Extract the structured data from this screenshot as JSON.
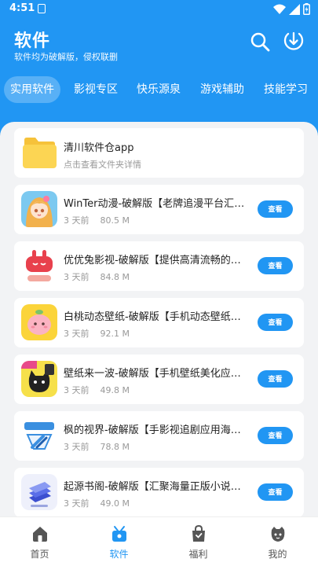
{
  "status_bar": {
    "time": "4:51"
  },
  "header": {
    "title": "软件",
    "subtitle": "软件均为破解版，侵权联删"
  },
  "tabs": [
    {
      "label": "实用软件",
      "active": true
    },
    {
      "label": "影视专区",
      "active": false
    },
    {
      "label": "快乐源泉",
      "active": false
    },
    {
      "label": "游戏辅助",
      "active": false
    },
    {
      "label": "技能学习",
      "active": false
    }
  ],
  "folder": {
    "name": "清川软件仓app",
    "hint": "点击查看文件夹详情"
  },
  "apps": [
    {
      "name": "WinTer动漫-破解版【老牌追漫平台汇聚海量动漫资源】",
      "time": "3 天前",
      "size": "80.5 M",
      "button": "查看",
      "icon": "anime-girl-icon"
    },
    {
      "name": "优优兔影视-破解版【提供高清流畅的影视资源】",
      "time": "3 天前",
      "size": "84.8 M",
      "button": "查看",
      "icon": "red-rabbit-icon"
    },
    {
      "name": "白桃动态壁纸-破解版【手机动态壁纸应用】",
      "time": "3 天前",
      "size": "92.1 M",
      "button": "查看",
      "icon": "peach-icon"
    },
    {
      "name": "壁纸来一波-破解版【手机壁纸美化应用】",
      "time": "3 天前",
      "size": "49.8 M",
      "button": "查看",
      "icon": "black-cat-icon"
    },
    {
      "name": "枫的视界-破解版【手影视追剧应用海量资源】",
      "time": "3 天前",
      "size": "78.8 M",
      "button": "查看",
      "icon": "fengde-icon"
    },
    {
      "name": "起源书阁-破解版【汇聚海量正版小说资源】",
      "time": "3 天前",
      "size": "49.0 M",
      "button": "查看",
      "icon": "books-icon"
    }
  ],
  "bottom_nav": [
    {
      "label": "首页",
      "icon": "home-icon",
      "active": false
    },
    {
      "label": "软件",
      "icon": "software-icon",
      "active": true
    },
    {
      "label": "福利",
      "icon": "gift-bag-icon",
      "active": false
    },
    {
      "label": "我的",
      "icon": "profile-icon",
      "active": false
    }
  ],
  "colors": {
    "primary": "#2196f3",
    "background": "#f2f3f5"
  }
}
